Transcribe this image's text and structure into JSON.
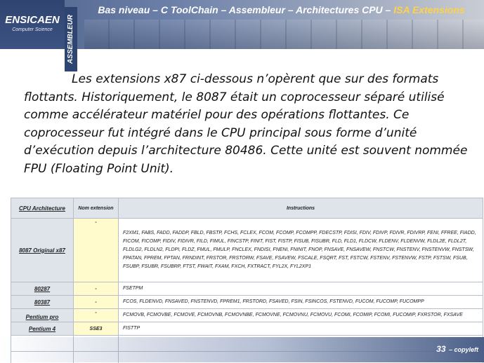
{
  "header": {
    "title_main": "Bas niveau – C ToolChain – Assembleur – Architectures CPU – ",
    "title_accent": "ISA Extensions",
    "vertical_label": "ASSEMBLEUR",
    "logo_title": "ENSICAEN",
    "logo_sub": "Computer Science",
    "accent_color": "#ffd24a"
  },
  "body": {
    "paragraph": "Les extensions x87 ci-dessous n’opèrent que sur des formats flottants. Historiquement, le 8087 était un coprocesseur séparé utilisé comme accélérateur matériel pour des opérations flottantes. Ce coprocesseur fut intégré dans le CPU principal sous forme d’unité d’exécution depuis l’architecture 80486. Cette unité est souvent nommée FPU (Floating Point Unit)."
  },
  "table": {
    "headers": [
      "CPU Architecture",
      "Nom extension",
      "Instructions"
    ],
    "rows": [
      {
        "cpu": "8087 Original x87",
        "ext": "-",
        "instr": "F2XM1, FABS, FADD, FADDP, FBLD, FBSTP, FCHS, FCLEX, FCOM, FCOMP, FCOMPP, FDECSTP, FDISI, FDIV, FDIVP, FDIVR, FDIVRP, FENI, FFREE, FIADD, FICOM, FICOMP, FIDIV, FIDIVR, FILD, FIMUL, FINCSTP, FINIT, FIST, FISTP, FISUB, FISUBR, FLD, FLD1, FLDCW, FLDENV, FLDENVW, FLDL2E, FLDL2T, FLDLG2, FLDLN2, FLDPI, FLDZ, FMUL, FMULP, FNCLEX, FNDISI, FNENI, FNINIT, FNOP, FNSAVE, FNSAVEW, FNSTCW, FNSTENV, FNSTENVW, FNSTSW, FPATAN, FPREM, FPTAN, FRNDINT, FRSTOR, FRSTORW, FSAVE, FSAVEW, FSCALE, FSQRT, FST, FSTCW, FSTENV, FSTENVW, FSTP, FSTSW, FSUB, FSUBP, FSUBR, FSUBRP, FTST, FWAIT, FXAM, FXCH, FXTRACT, FYL2X, FYL2XP1"
      },
      {
        "cpu": "80287",
        "ext": "-",
        "instr": "FSETPM"
      },
      {
        "cpu": "80387",
        "ext": "-",
        "instr": "FCOS, FLDENVD, FNSAVED, FNSTENVD, FPREM1, FRSTORD, FSAVED, FSIN, FSINCOS, FSTENVD, FUCOM, FUCOMP, FUCOMPP"
      },
      {
        "cpu": "Pentium pro",
        "ext": "-",
        "instr": "FCMOVB, FCMOVBE, FCMOVE, FCMOVNB, FCMOVNBE, FCMOVNE, FCMOVNU, FCMOVU, FCOMI, FCOMIP, FCOMI, FUCOMIP, FXRSTOR, FXSAVE"
      },
      {
        "cpu": "Pentium 4",
        "ext": "SSE3",
        "instr": "FISTTP"
      }
    ]
  },
  "footer": {
    "page_number": "33",
    "tag": "– copyleft"
  }
}
